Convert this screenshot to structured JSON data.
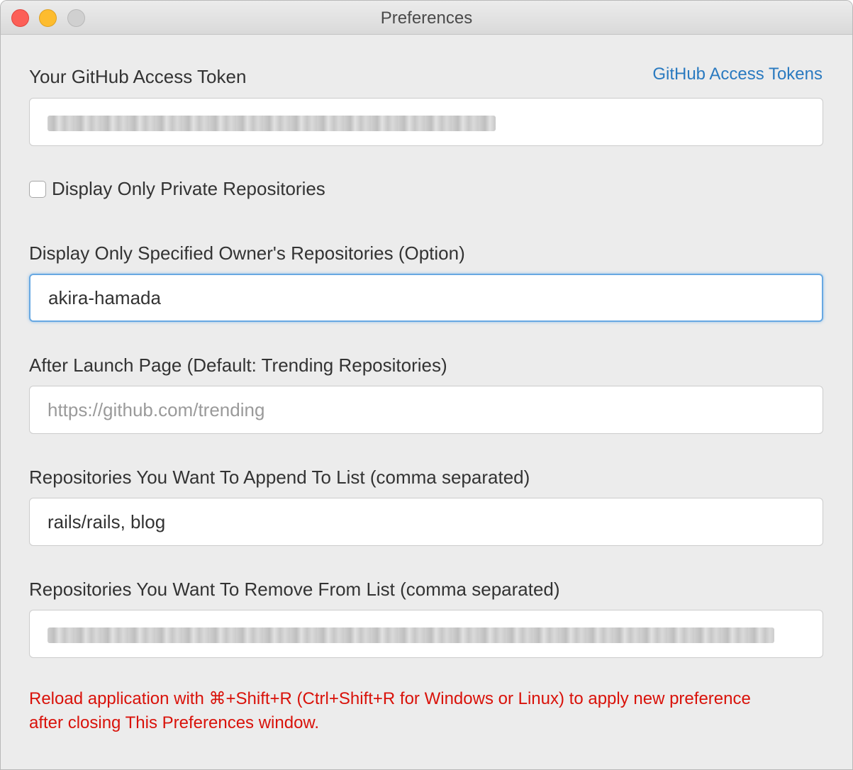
{
  "window": {
    "title": "Preferences"
  },
  "token": {
    "label": "Your GitHub Access Token",
    "link": "GitHub Access Tokens"
  },
  "private_only": {
    "label": "Display Only Private Repositories",
    "checked": false
  },
  "owner": {
    "label": "Display Only Specified Owner's Repositories (Option)",
    "value": "akira-hamada"
  },
  "launch_page": {
    "label": "After Launch Page (Default: Trending Repositories)",
    "placeholder": "https://github.com/trending"
  },
  "append": {
    "label": "Repositories You Want To Append To List (comma separated)",
    "value": "rails/rails, blog"
  },
  "remove": {
    "label": "Repositories You Want To Remove From List (comma separated)"
  },
  "notice": {
    "line1": "Reload application with ⌘+Shift+R (Ctrl+Shift+R for Windows or Linux) to apply new preference",
    "line2": "after closing This Preferences window."
  },
  "colors": {
    "link": "#2a7ac0",
    "notice": "#d9120a",
    "focus_ring": "#68a8e2"
  }
}
